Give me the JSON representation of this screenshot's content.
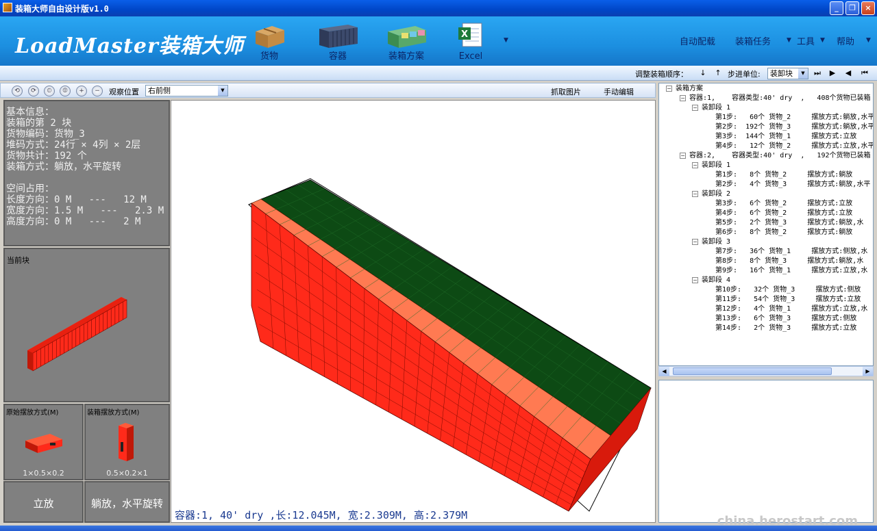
{
  "window": {
    "title": "装箱大师自由设计版v1.0"
  },
  "banner": {
    "logo": "LoadMaster装箱大师",
    "tools": [
      {
        "label": "货物",
        "icon": "cargo-box-icon"
      },
      {
        "label": "容器",
        "icon": "container-icon"
      },
      {
        "label": "装箱方案",
        "icon": "loading-plan-icon"
      },
      {
        "label": "Excel",
        "icon": "excel-icon"
      }
    ],
    "menus": [
      "自动配载",
      "装箱任务",
      "工具",
      "帮助"
    ]
  },
  "orderbar": {
    "adjust_label": "调整装箱顺序：",
    "step_label": "步进单位:",
    "step_value": "装卸块"
  },
  "viewbar": {
    "observe_label": "观察位置",
    "observe_value": "右前侧",
    "capture_label": "抓取图片",
    "manual_edit_label": "手动编辑"
  },
  "info": {
    "lines": [
      "基本信息：",
      "装箱的第 2 块",
      "货物编码：货物_3",
      "堆码方式：24行 × 4列 × 2层",
      "货物共计：192 个",
      "装箱方式：躺放，水平旋转",
      "",
      "空间占用：",
      "长度方向：0 M   ---   12 M",
      "宽度方向：1.5 M   ---   2.3 M",
      "高度方向：0 M   ---   2 M"
    ]
  },
  "current_block": {
    "title": "当前块"
  },
  "orientation": {
    "original_title": "原始摆放方式(M)",
    "original_dims": "1×0.5×0.2",
    "loading_title": "装箱摆放方式(M)",
    "loading_dims": "0.5×0.2×1",
    "original_mode": "立放",
    "loading_mode": "躺放，水平旋转"
  },
  "viewport": {
    "caption": "容器:1, 40' dry ,长:12.045M, 宽:2.309M, 高:2.379M"
  },
  "tree": {
    "rows": [
      {
        "indent": 0,
        "exp": true,
        "text": "装箱方案"
      },
      {
        "indent": 1,
        "exp": true,
        "text": "容器:1,    容器类型:40' dry  ,   408个货物已装箱"
      },
      {
        "indent": 2,
        "exp": true,
        "text": "装卸段 1"
      },
      {
        "indent": 3,
        "exp": false,
        "text": "第1步:   60个 货物_2     摆放方式:躺放,水平"
      },
      {
        "indent": 3,
        "exp": false,
        "text": "第2步:  192个 货物_3     摆放方式:躺放,水平"
      },
      {
        "indent": 3,
        "exp": false,
        "text": "第3步:  144个 货物_1     摆放方式:立放"
      },
      {
        "indent": 3,
        "exp": false,
        "text": "第4步:   12个 货物_2     摆放方式:立放,水平"
      },
      {
        "indent": 1,
        "exp": true,
        "text": "容器:2,    容器类型:40' dry  ,   192个货物已装箱"
      },
      {
        "indent": 2,
        "exp": true,
        "text": "装卸段 1"
      },
      {
        "indent": 3,
        "exp": false,
        "text": "第1步:   8个 货物_2     摆放方式:躺放"
      },
      {
        "indent": 3,
        "exp": false,
        "text": "第2步:   4个 货物_3     摆放方式:躺放,水平"
      },
      {
        "indent": 2,
        "exp": true,
        "text": "装卸段 2"
      },
      {
        "indent": 3,
        "exp": false,
        "text": "第3步:   6个 货物_2     摆放方式:立放"
      },
      {
        "indent": 3,
        "exp": false,
        "text": "第4步:   6个 货物_2     摆放方式:立放"
      },
      {
        "indent": 3,
        "exp": false,
        "text": "第5步:   2个 货物_3     摆放方式:躺放,水"
      },
      {
        "indent": 3,
        "exp": false,
        "text": "第6步:   8个 货物_2     摆放方式:躺放"
      },
      {
        "indent": 2,
        "exp": true,
        "text": "装卸段 3"
      },
      {
        "indent": 3,
        "exp": false,
        "text": "第7步:   36个 货物_1     摆放方式:侧放,水"
      },
      {
        "indent": 3,
        "exp": false,
        "text": "第8步:   8个 货物_3     摆放方式:躺放,水"
      },
      {
        "indent": 3,
        "exp": false,
        "text": "第9步:   16个 货物_1     摆放方式:立放,水"
      },
      {
        "indent": 2,
        "exp": true,
        "text": "装卸段 4"
      },
      {
        "indent": 3,
        "exp": false,
        "text": "第10步:   32个 货物_3     摆放方式:侧放"
      },
      {
        "indent": 3,
        "exp": false,
        "text": "第11步:   54个 货物_3     摆放方式:立放"
      },
      {
        "indent": 3,
        "exp": false,
        "text": "第12步:   4个 货物_1     摆放方式:立放,水"
      },
      {
        "indent": 3,
        "exp": false,
        "text": "第13步:   6个 货物_3     摆放方式:侧放"
      },
      {
        "indent": 3,
        "exp": false,
        "text": "第14步:   2个 货物_3     摆放方式:立放"
      }
    ]
  },
  "watermark": "china.herostart.com",
  "colors": {
    "box_side": "#ff2a1a",
    "box_top_band": "#ff7a52",
    "box_top": "#0d4a14",
    "banner": "#1c8fe0"
  }
}
